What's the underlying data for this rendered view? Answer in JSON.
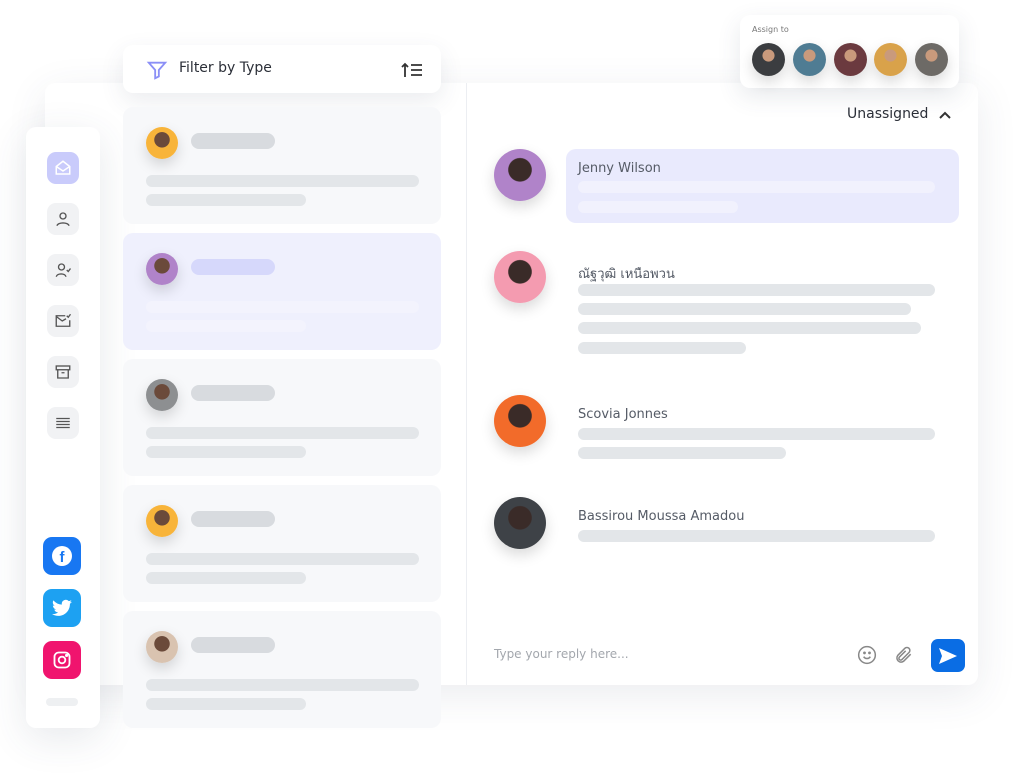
{
  "filter": {
    "label": "Filter by Type",
    "icon": "funnel-icon",
    "sort_icon": "sort-icon"
  },
  "sidebar": {
    "items": [
      {
        "name": "inbox",
        "icon": "envelope-open-icon",
        "active": true
      },
      {
        "name": "contacts",
        "icon": "user-icon"
      },
      {
        "name": "assigned",
        "icon": "user-check-icon"
      },
      {
        "name": "resolved",
        "icon": "mail-check-icon"
      },
      {
        "name": "archive",
        "icon": "archive-icon"
      },
      {
        "name": "menu",
        "icon": "list-icon"
      }
    ],
    "social": [
      {
        "name": "facebook",
        "color": "#1877f2"
      },
      {
        "name": "twitter",
        "color": "#1da1f2"
      },
      {
        "name": "instagram",
        "color": "#f0146e"
      }
    ]
  },
  "conversations": [
    {
      "avatar": "#f8b43a",
      "selected": false
    },
    {
      "avatar": "#b083c9",
      "selected": true
    },
    {
      "avatar": "#8d8f91",
      "selected": false
    },
    {
      "avatar": "#f8b43a",
      "selected": false
    },
    {
      "avatar": "#d9c3b0",
      "selected": false
    }
  ],
  "assign": {
    "label": "Assign to",
    "avatars": [
      "#3b3d40",
      "#4f7c93",
      "#6b3a3f",
      "#d9a24a",
      "#6d6a66"
    ]
  },
  "header": {
    "status": "Unassigned"
  },
  "messages": [
    {
      "name": "Jenny Wilson",
      "avatar": "#b083c9",
      "highlighted": true
    },
    {
      "name": "ณัฐวุฒิ เหนือพวน",
      "avatar": "#f49bb0"
    },
    {
      "name": "Scovia Jonnes",
      "avatar": "#f26b2a"
    },
    {
      "name": "Bassirou Moussa Amadou",
      "avatar": "#3e4247"
    }
  ],
  "composer": {
    "placeholder": "Type your reply here...",
    "send_color": "#0a6de4"
  }
}
